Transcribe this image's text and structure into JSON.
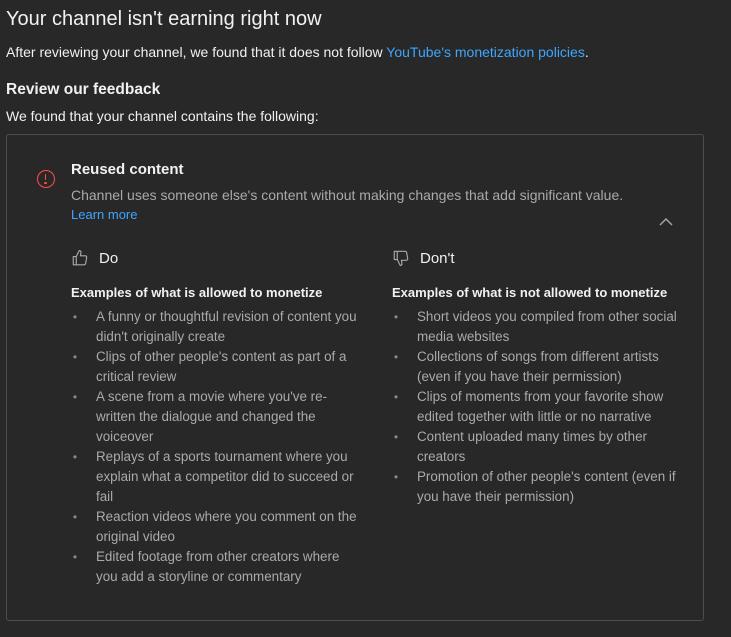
{
  "header": {
    "title": "Your channel isn't earning right now",
    "intro_text": "After reviewing your channel, we found that it does not follow ",
    "policy_link": "YouTube's monetization policies",
    "intro_end": "."
  },
  "feedback": {
    "heading": "Review our feedback",
    "subheading": "We found that your channel contains the following:"
  },
  "issue": {
    "title": "Reused content",
    "description": "Channel uses someone else's content without making changes that add significant value.",
    "learn_more": "Learn more",
    "icon": "alert-circle-icon",
    "icon_color": "#ff4e45",
    "expanded": true
  },
  "do_column": {
    "label": "Do",
    "icon": "thumbs-up-icon",
    "subtitle": "Examples of what is allowed to monetize",
    "items": [
      "A funny or thoughtful revision of content you didn't originally create",
      "Clips of other people's content as part of a critical review",
      "A scene from a movie where you've re-written the dialogue and changed the voiceover",
      "Replays of a sports tournament where you explain what a competitor did to succeed or fail",
      "Reaction videos where you comment on the original video",
      "Edited footage from other creators where you add a storyline or commentary"
    ]
  },
  "dont_column": {
    "label": "Don't",
    "icon": "thumbs-down-icon",
    "subtitle": "Examples of what is not allowed to monetize",
    "items": [
      "Short videos you compiled from other social media websites",
      "Collections of songs from different artists (even if you have their permission)",
      "Clips of moments from your favorite show edited together with little or no narrative",
      "Content uploaded many times by other creators",
      "Promotion of other people's content (even if you have their permission)"
    ]
  },
  "colors": {
    "background": "#282828",
    "text_primary": "#f1f1f1",
    "text_secondary": "#aaaaaa",
    "link": "#3ea6ff",
    "border": "#4d4d4d"
  }
}
